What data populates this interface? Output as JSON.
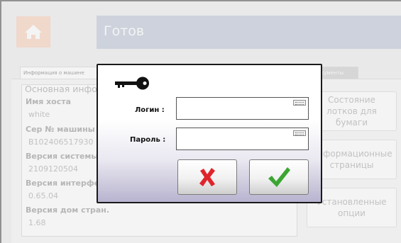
{
  "header": {
    "title": "Готов",
    "home_icon": "home-icon"
  },
  "tabs": [
    {
      "label": "Информация о машине"
    },
    {
      "label": ""
    },
    {
      "label": "кументы"
    }
  ],
  "info": {
    "section_title": "Основная информация",
    "fields": [
      {
        "label": "Имя хоста",
        "value": "white"
      },
      {
        "label": "Сер № машины",
        "value": "B102406517930"
      },
      {
        "label": "Версия системы",
        "value": "2109120504"
      },
      {
        "label": "Версия интерфейса",
        "value": "0.65.04"
      },
      {
        "label": "Версия дом стран.",
        "value": "1.68"
      }
    ]
  },
  "side_buttons": [
    {
      "label": "Состояние лотков для бумаги"
    },
    {
      "label": "Информационные страницы"
    },
    {
      "label": "Установленные опции"
    }
  ],
  "dialog": {
    "icon": "key-icon",
    "login_label": "Логин :",
    "password_label": "Пароль :",
    "login_value": "",
    "password_value": "",
    "cancel_icon": "red-x-icon",
    "ok_icon": "green-check-icon"
  },
  "colors": {
    "header_bar": "#b9c2d3",
    "home_button": "#f8cdb4",
    "cancel": "#e0242b",
    "ok": "#3aa632"
  }
}
